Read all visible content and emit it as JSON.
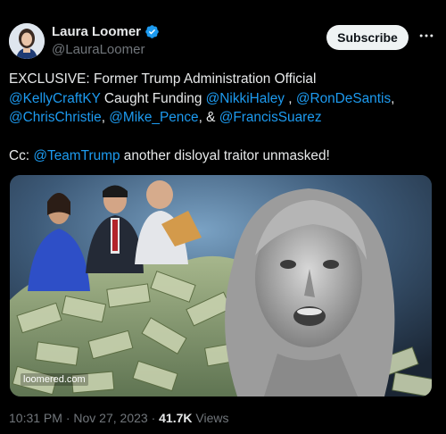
{
  "author": {
    "name": "Laura Loomer",
    "handle": "@LauraLoomer",
    "verified": true
  },
  "actions": {
    "subscribe_label": "Subscribe",
    "more_icon": "more-horizontal-icon"
  },
  "tweet": {
    "lines": [
      [
        {
          "t": "EXCLUSIVE: Former Trump Administration Official",
          "m": false
        }
      ],
      [
        {
          "t": "@KellyCraftKY",
          "m": true
        },
        {
          "t": " Caught Funding ",
          "m": false
        },
        {
          "t": "@NikkiHaley",
          "m": true
        },
        {
          "t": " , ",
          "m": false
        },
        {
          "t": "@RonDeSantis",
          "m": true
        },
        {
          "t": ",",
          "m": false
        }
      ],
      [
        {
          "t": "@ChrisChristie",
          "m": true
        },
        {
          "t": ", ",
          "m": false
        },
        {
          "t": "@Mike_Pence",
          "m": true
        },
        {
          "t": ", & ",
          "m": false
        },
        {
          "t": "@FrancisSuarez",
          "m": true
        }
      ],
      [
        {
          "t": "",
          "m": false
        }
      ],
      [
        {
          "t": "Cc: ",
          "m": false
        },
        {
          "t": "@TeamTrump",
          "m": true
        },
        {
          "t": " another disloyal traitor unmasked!",
          "m": false
        }
      ]
    ]
  },
  "media": {
    "watermark": "loomered.com"
  },
  "meta": {
    "time": "10:31 PM",
    "date": "Nov 27, 2023",
    "sep": " · ",
    "views_count": "41.7K",
    "views_label": "Views"
  },
  "colors": {
    "mention": "#1d9bf0",
    "verified": "#1d9bf0",
    "background": "#000000"
  }
}
